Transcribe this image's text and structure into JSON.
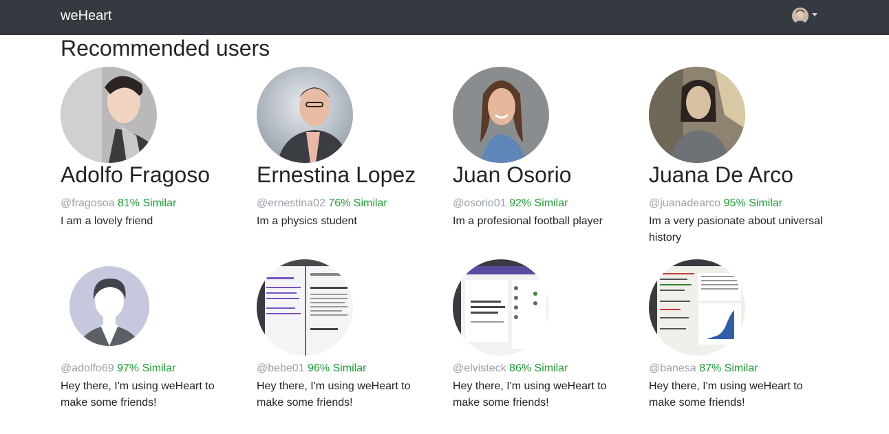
{
  "navbar": {
    "brand": "weHeart",
    "user_avatar_icon": "user-avatar-icon"
  },
  "page": {
    "title": "Recommended users"
  },
  "colors": {
    "navbar_bg": "#343a40",
    "similar_green": "#1e9e34",
    "handle_gray": "#9aa0a6"
  },
  "users": [
    {
      "name": "Adolfo Fragoso",
      "handle": "@fragosoa",
      "similarity": "81% Similar",
      "bio": "I am a lovely friend",
      "photo": "young man portrait"
    },
    {
      "name": "Ernestina Lopez",
      "handle": "@ernestina02",
      "similarity": "76% Similar",
      "bio": "Im a physics student",
      "photo": "man in suit portrait"
    },
    {
      "name": "Juan Osorio",
      "handle": "@osorio01",
      "similarity": "92% Similar",
      "bio": "Im a profesional football player",
      "photo": "smiling woman portrait"
    },
    {
      "name": "Juana De Arco",
      "handle": "@juanadearco",
      "similarity": "95% Similar",
      "bio": "Im a very pasionate about universal history",
      "photo": "painting of joan of arc"
    },
    {
      "name": "",
      "handle": "@adolfo69",
      "similarity": "97% Similar",
      "bio": "Hey there, I'm using weHeart to make some friends!",
      "photo": "default avatar silhouette"
    },
    {
      "name": "",
      "handle": "@bebe01",
      "similarity": "96% Similar",
      "bio": "Hey there, I'm using weHeart to make some friends!",
      "photo": "screenshot of web page"
    },
    {
      "name": "",
      "handle": "@elvisteck",
      "similarity": "86% Similar",
      "bio": "Hey there, I'm using weHeart to make some friends!",
      "photo": "screenshot of social page"
    },
    {
      "name": "",
      "handle": "@banesa",
      "similarity": "87% Similar",
      "bio": "Hey there, I'm using weHeart to make some friends!",
      "photo": "screenshot of code editor with chart"
    }
  ]
}
